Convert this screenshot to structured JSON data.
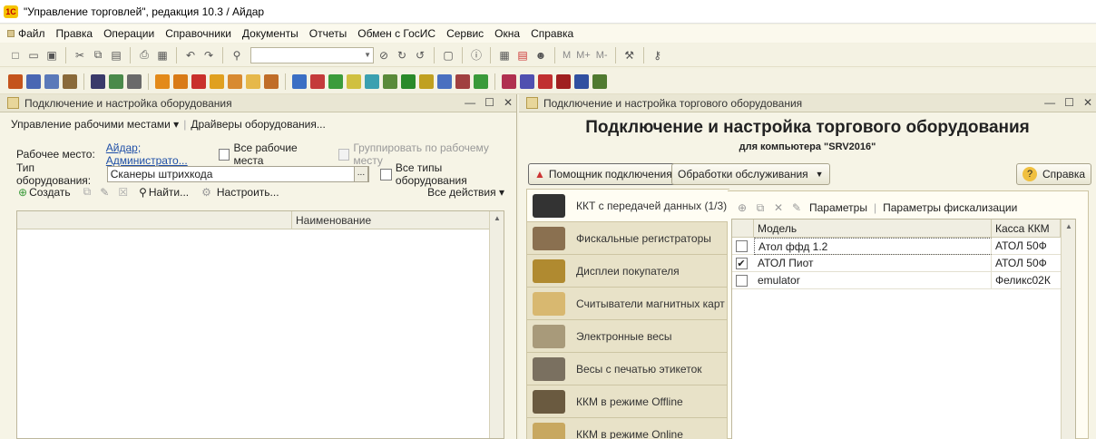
{
  "window": {
    "title": "\"Управление торговлей\", редакция 10.3 / Айдар",
    "logo": "1С"
  },
  "menu": [
    "Файл",
    "Правка",
    "Операции",
    "Справочники",
    "Документы",
    "Отчеты",
    "Обмен с ГосИС",
    "Сервис",
    "Окна",
    "Справка"
  ],
  "toolbar": {
    "m": "M",
    "mplus": "M+",
    "mminus": "M-"
  },
  "left": {
    "title": "Подключение и настройка оборудования",
    "manage": "Управление рабочими местами",
    "drivers": "Драйверы оборудования...",
    "workplace_label": "Рабочее место:",
    "workplace_value": "Айдар; Администрато...",
    "all_workplaces": "Все рабочие места",
    "group_by": "Группировать по рабочему месту",
    "type_label": "Тип оборудования:",
    "type_value": "Сканеры штрихкода",
    "all_types": "Все типы оборудования",
    "create": "Создать",
    "find": "Найти...",
    "setup": "Настроить...",
    "all_actions": "Все действия",
    "col_name": "Наименование"
  },
  "right": {
    "title": "Подключение и настройка торгового оборудования",
    "heading": "Подключение и настройка торгового оборудования",
    "subheading": "для компьютера \"SRV2016\"",
    "assistant": "Помощник подключения",
    "service": "Обработки обслуживания",
    "help": "Справка",
    "params": "Параметры",
    "fiscal_params": "Параметры фискализации",
    "tabs": [
      {
        "label": "ККТ с передачей данных (1/3)",
        "icon": "kkt-icon"
      },
      {
        "label": "Фискальные регистраторы",
        "icon": "fiscal-icon"
      },
      {
        "label": "Дисплеи покупателя",
        "icon": "display-icon"
      },
      {
        "label": "Считыватели магнитных карт",
        "icon": "card-reader-icon"
      },
      {
        "label": "Электронные весы",
        "icon": "scales-icon"
      },
      {
        "label": "Весы с печатью этикеток",
        "icon": "label-scales-icon"
      },
      {
        "label": "ККМ в режиме Offline",
        "icon": "kkm-offline-icon"
      },
      {
        "label": "ККМ в режиме Online",
        "icon": "kkm-online-icon"
      }
    ],
    "table": {
      "columns": [
        "Модель",
        "Касса ККМ"
      ],
      "rows": [
        {
          "model": "Атол ффд 1.2",
          "kkm": "АТОЛ 50Ф",
          "checked": false,
          "selected": true
        },
        {
          "model": "АТОЛ Пиот",
          "kkm": "АТОЛ 50Ф",
          "checked": true,
          "selected": false
        },
        {
          "model": "emulator",
          "kkm": "Феликс02К",
          "checked": false,
          "selected": false
        }
      ]
    }
  }
}
